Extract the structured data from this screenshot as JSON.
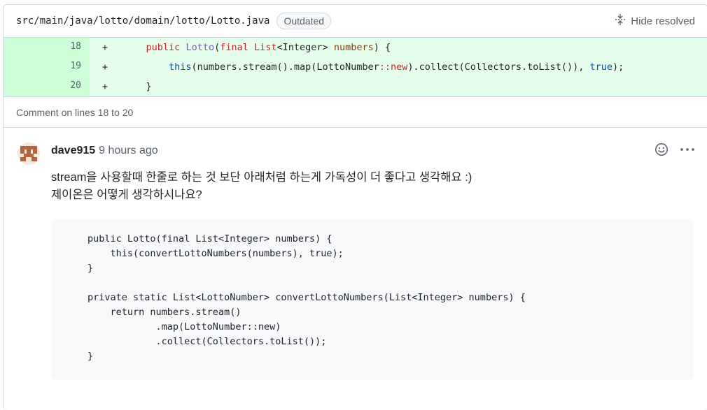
{
  "file": {
    "path": "src/main/java/lotto/domain/lotto/Lotto.java",
    "badge": "Outdated",
    "hide_resolved": "Hide resolved"
  },
  "diff": {
    "lines": [
      {
        "number": "18",
        "marker": "+"
      },
      {
        "number": "19",
        "marker": "+"
      },
      {
        "number": "20",
        "marker": "+"
      }
    ],
    "code": {
      "l18_indent": "    ",
      "l18_public": "public",
      "l18_class": "Lotto",
      "l18_paren": "(",
      "l18_final": "final",
      "l18_list": "List",
      "l18_type": "<Integer>",
      "l18_param": "numbers",
      "l18_end": ") {",
      "l19_indent": "        ",
      "l19_this": "this",
      "l19_a": "(numbers.stream().map(LottoNumber",
      "l19_ref": "::new",
      "l19_b": ").collect(Collectors.toList()), ",
      "l19_true": "true",
      "l19_end": ");",
      "l20": "    }"
    }
  },
  "comment_on": "Comment on lines 18 to 20",
  "comment": {
    "author": "dave915",
    "time": "9 hours ago",
    "body_line1": "stream을 사용할때 한줄로 하는 것 보단 아래처럼 하는게 가독성이 더 좋다고 생각해요 :)",
    "body_line2": "제이온은 어떻게 생각하시나요?",
    "code": "public Lotto(final List<Integer> numbers) {\n    this(convertLottoNumbers(numbers), true);\n}\n\nprivate static List<LottoNumber> convertLottoNumbers(List<Integer> numbers) {\n    return numbers.stream()\n            .map(LottoNumber::new)\n            .collect(Collectors.toList());\n}"
  },
  "icons": {
    "hide_resolved": "fold-icon",
    "reaction": "smiley-icon",
    "more": "kebab-horizontal-icon"
  },
  "colors": {
    "added_line_bg": "#e6ffec",
    "added_gutter_bg": "#ccffd8",
    "code_block_bg": "#f6f8fa"
  }
}
